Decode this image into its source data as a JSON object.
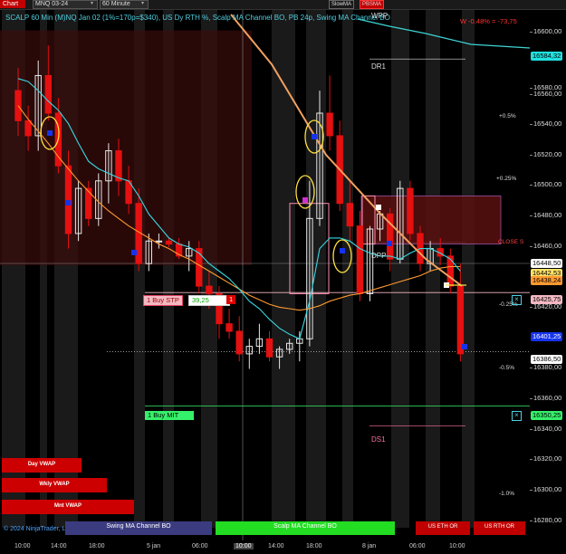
{
  "toolbar": {
    "tab": "Chart",
    "instrument": "MNQ 03-24",
    "interval": "60 Minute",
    "btn_slowma": "SlowMA",
    "btn_pbsma": "PBSMA"
  },
  "chart_title": "SCALP 60 Min (M)NQ Jan 02 (1%=170p=$340), US Dy RTH %, Scalp MA Channel BO, PB 24p, Swing MA Channel BO",
  "weekly_label": "WPP",
  "week_stat": "W -0,48% = -73,75",
  "levels": {
    "dr1": "DR1",
    "dpp": "DPP",
    "ds1": "DS1",
    "close_s": "CLOSE S"
  },
  "pct_labels": [
    "+0.5%",
    "+0.25%",
    "-0.25%",
    "-0.5%",
    "-1.0%"
  ],
  "orders": {
    "stop_label": "1 Buy STP",
    "stop_price": "39,25",
    "stop_qty": "1",
    "mit_label": "1 Buy MIT"
  },
  "y_ticks": [
    "16600,00",
    "16580,00",
    "16560,00",
    "16540,00",
    "16520,00",
    "16500,00",
    "16480,00",
    "16460,00",
    "16420,00",
    "16380,00",
    "16360,00",
    "16340,00",
    "16320,00",
    "16300,00",
    "16280,00"
  ],
  "price_labels": {
    "p1": "16584,32",
    "p2": "16448,50",
    "p3": "16442,53",
    "p4": "16438,24",
    "p5": "16425,75",
    "p6": "16401,25",
    "p7": "16386,50",
    "p8": "16350,25"
  },
  "x_ticks": [
    "10:00",
    "14:00",
    "18:00",
    "5 jan",
    "06:00",
    "10:00",
    "14:00",
    "18:00",
    "8 jan",
    "06:00",
    "10:00"
  ],
  "vwap_labels": [
    "Day VWAP",
    "Wkly VWAP",
    "Mnt VWAP"
  ],
  "copyright": "© 2024 NinjaTrader, LLC",
  "bottom_bars": {
    "swing": "Swing MA Channel BO",
    "scalp": "Scalp MA Channel BO",
    "eth": "US ETH OR",
    "rth": "US RTH OR"
  },
  "colors": {
    "bull": "#e8e8e8",
    "bear": "#e51010",
    "fast_ma": "#38d8e0",
    "slow_ma": "#ff9a30",
    "weekly_ma": "#3fd4d4"
  },
  "chart_data": {
    "type": "candlestick",
    "instrument": "MNQ 03-24",
    "interval": "60 Minute",
    "ylim": [
      16270,
      16610
    ],
    "candles": [
      [
        16560,
        16575,
        16530,
        16540
      ],
      [
        16540,
        16550,
        16520,
        16530
      ],
      [
        16530,
        16580,
        16520,
        16570
      ],
      [
        16570,
        16590,
        16540,
        16545
      ],
      [
        16545,
        16555,
        16505,
        16510
      ],
      [
        16510,
        16520,
        16455,
        16465
      ],
      [
        16465,
        16500,
        16460,
        16495
      ],
      [
        16495,
        16500,
        16470,
        16475
      ],
      [
        16475,
        16505,
        16470,
        16500
      ],
      [
        16500,
        16525,
        16485,
        16520
      ],
      [
        16520,
        16528,
        16490,
        16500
      ],
      [
        16500,
        16510,
        16478,
        16485
      ],
      [
        16485,
        16495,
        16440,
        16445
      ],
      [
        16445,
        16465,
        16440,
        16460
      ],
      [
        16460,
        16465,
        16455,
        16460
      ],
      [
        16460,
        16462,
        16456,
        16458
      ],
      [
        16458,
        16462,
        16448,
        16450
      ],
      [
        16450,
        16460,
        16440,
        16455
      ],
      [
        16455,
        16460,
        16425,
        16430
      ],
      [
        16430,
        16440,
        16415,
        16425
      ],
      [
        16425,
        16430,
        16395,
        16405
      ],
      [
        16405,
        16415,
        16395,
        16400
      ],
      [
        16400,
        16410,
        16380,
        16385
      ],
      [
        16385,
        16395,
        16375,
        16390
      ],
      [
        16390,
        16405,
        16385,
        16395
      ],
      [
        16395,
        16400,
        16380,
        16383
      ],
      [
        16383,
        16390,
        16375,
        16388
      ],
      [
        16388,
        16395,
        16385,
        16392
      ],
      [
        16392,
        16400,
        16380,
        16395
      ],
      [
        16395,
        16500,
        16390,
        16475
      ],
      [
        16475,
        16560,
        16470,
        16545
      ],
      [
        16545,
        16570,
        16520,
        16530
      ],
      [
        16530,
        16540,
        16480,
        16485
      ],
      [
        16485,
        16500,
        16460,
        16470
      ],
      [
        16470,
        16480,
        16420,
        16425
      ],
      [
        16425,
        16470,
        16420,
        16468
      ],
      [
        16468,
        16480,
        16460,
        16478
      ],
      [
        16478,
        16482,
        16440,
        16448
      ],
      [
        16448,
        16500,
        16445,
        16495
      ],
      [
        16495,
        16500,
        16460,
        16465
      ],
      [
        16465,
        16470,
        16440,
        16445
      ],
      [
        16445,
        16460,
        16440,
        16455
      ],
      [
        16455,
        16462,
        16444,
        16450
      ],
      [
        16450,
        16455,
        16425,
        16430
      ],
      [
        16430,
        16445,
        16380,
        16385
      ]
    ],
    "series": [
      {
        "name": "SlowMA",
        "values": [
          16550,
          16541,
          16533,
          16525,
          16516,
          16508,
          16500,
          16493,
          16486,
          16480,
          16475,
          16470,
          16466,
          16462,
          16458,
          16455,
          16451,
          16448,
          16444,
          16440,
          16436,
          16432,
          16428,
          16424,
          16421,
          16418,
          16416,
          16415,
          16414,
          16415,
          16417,
          16420,
          16422,
          16424,
          16425,
          16427,
          16429,
          16431,
          16433,
          16435,
          16437,
          16440,
          16442,
          16443,
          16443
        ]
      },
      {
        "name": "PBSMA",
        "values": [
          16568,
          16566,
          16560,
          16553,
          16547,
          16538,
          16525,
          16513,
          16508,
          16505,
          16502,
          16500,
          16490,
          16478,
          16470,
          16462,
          16458,
          16456,
          16452,
          16445,
          16440,
          16435,
          16428,
          16420,
          16415,
          16408,
          16402,
          16398,
          16395,
          16420,
          16455,
          16462,
          16462,
          16460,
          16455,
          16452,
          16450,
          16450,
          16448,
          16452,
          16455,
          16455,
          16452,
          16448,
          16440
        ]
      }
    ]
  }
}
